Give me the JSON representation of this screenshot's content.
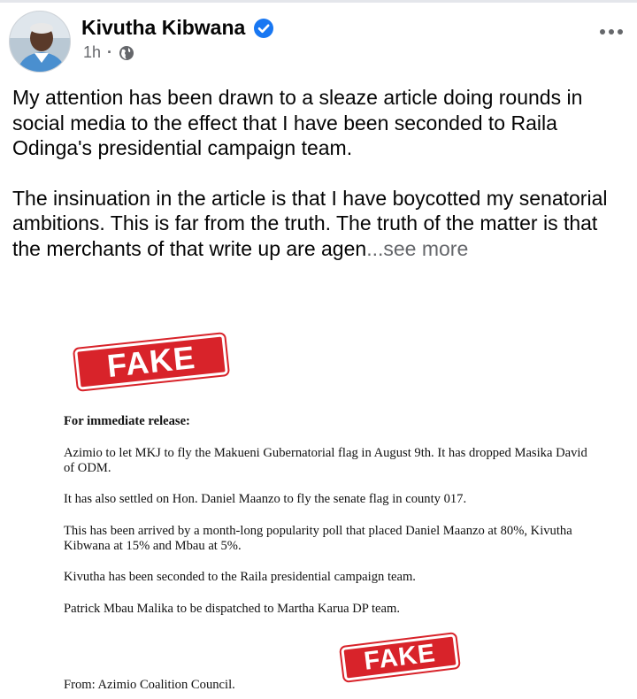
{
  "post": {
    "author": "Kivutha Kibwana",
    "time": "1h",
    "separator": "·",
    "paragraph1": "My attention has been drawn to a sleaze article doing rounds in social media to the effect that I have been seconded to Raila Odinga's presidential campaign team.",
    "paragraph2": "The insinuation in the article is that I have boycotted my senatorial ambitions. This is far from the truth. The truth of the matter is that the merchants of that write up are agen",
    "see_more": "...see more"
  },
  "image": {
    "stamp_top": "FAKE",
    "stamp_bottom": "FAKE",
    "heading": "For immediate release:",
    "lines": [
      "Azimio to let MKJ to fly the Makueni Gubernatorial flag in August 9th. It has dropped Masika David of ODM.",
      "It has also settled on Hon. Daniel Maanzo to fly the senate flag in county 017.",
      "This has been arrived by a month-long popularity poll that placed Daniel Maanzo at 80%, Kivutha Kibwana at 15% and Mbau at 5%.",
      "Kivutha has been seconded to the Raila presidential campaign team.",
      "Patrick Mbau Malika to be dispatched to Martha Karua DP team."
    ],
    "from": "From: Azimio Coalition Council."
  },
  "icons": {
    "verified": "verified-badge-icon",
    "audience": "globe-icon",
    "menu": "more-options-icon"
  },
  "colors": {
    "verified_blue": "#1877f2",
    "secondary_text": "#65676b",
    "stamp_red": "#d8232a"
  }
}
